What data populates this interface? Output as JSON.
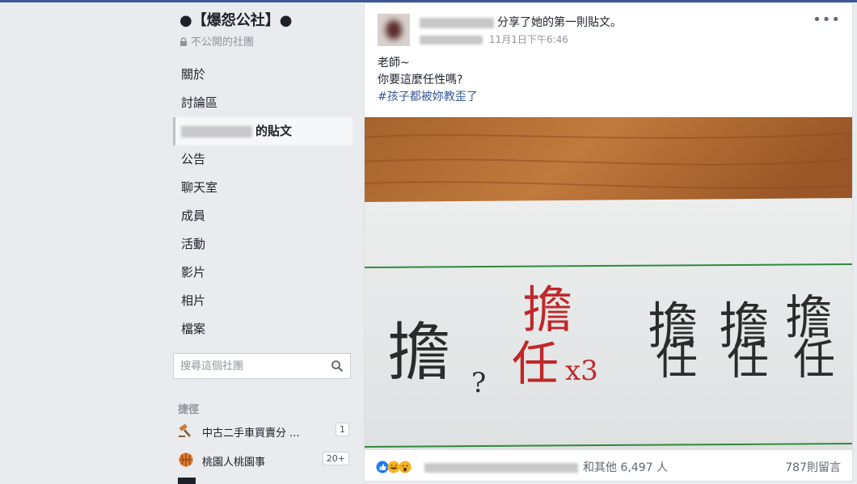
{
  "group": {
    "title": "●【爆怨公社】●",
    "privacy": "不公開的社團"
  },
  "nav": [
    {
      "label": "關於"
    },
    {
      "label": "討論區"
    },
    {
      "label": "的貼文"
    },
    {
      "label": "公告"
    },
    {
      "label": "聊天室"
    },
    {
      "label": "成員"
    },
    {
      "label": "活動"
    },
    {
      "label": "影片"
    },
    {
      "label": "相片"
    },
    {
      "label": "檔案"
    }
  ],
  "search": {
    "placeholder": "搜尋這個社團"
  },
  "shortcuts": {
    "heading": "捷徑",
    "items": [
      {
        "label": "中古二手車買賣分 ...",
        "badge": "1",
        "icon": "gavel-icon"
      },
      {
        "label": "桃園人桃園事",
        "badge": "20+",
        "icon": "basketball-icon"
      }
    ]
  },
  "post": {
    "header_text": "分享了她的第一則貼文。",
    "timestamp": "11月1日下午6:46",
    "lines": [
      "老師~",
      "你要這麼任性嗎?"
    ],
    "hashtag": "#孩子都被妳教歪了",
    "photo_chars": {
      "left": "擔",
      "question": "?",
      "red_top": "擔",
      "red_bottom": "任",
      "red_mark": "x3",
      "c1_top": "擔",
      "c1_bottom": "任",
      "c2_top": "擔",
      "c2_bottom": "任",
      "c3_top": "擔",
      "c3_bottom": "任"
    },
    "reactions_others": "和其他 6,497 人",
    "comments_count": "787則留言"
  },
  "colors": {
    "accent": "#3b5998",
    "link": "#365899",
    "like": "#2078f4",
    "haha": "#f7b125",
    "red_ink": "#c0282a"
  }
}
